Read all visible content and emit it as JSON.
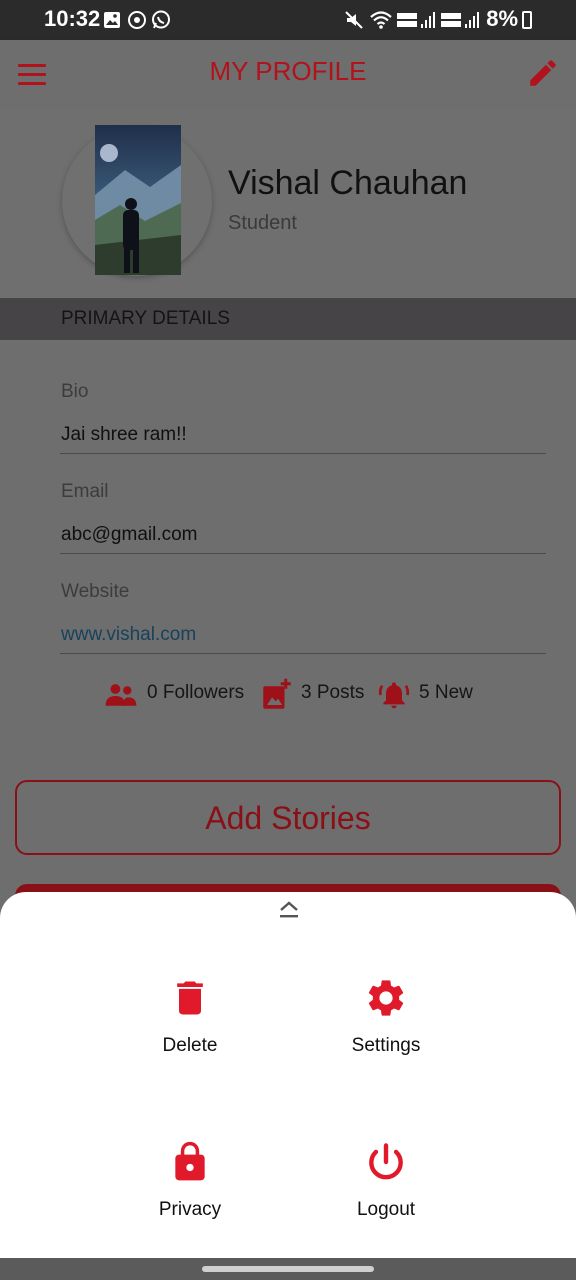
{
  "status_bar": {
    "time": "10:32",
    "battery": "8%"
  },
  "toolbar": {
    "title": "MY PROFILE",
    "menu_icon": "menu-icon",
    "edit_icon": "edit-pencil-icon"
  },
  "profile": {
    "name": "Vishal Chauhan",
    "role": "Student"
  },
  "section": {
    "title": "PRIMARY DETAILS"
  },
  "fields": [
    {
      "label": "Bio",
      "value": "Jai shree ram!!"
    },
    {
      "label": "Email",
      "value": "abc@gmail.com"
    },
    {
      "label": "Website",
      "value": "www.vishal.com"
    }
  ],
  "stats": {
    "followers": "0 Followers",
    "posts": "3 Posts",
    "notifications": "5 New"
  },
  "actions": {
    "add_stories": "Add Stories"
  },
  "sheet": {
    "items": [
      {
        "label": "Delete",
        "icon": "trash-icon"
      },
      {
        "label": "Settings",
        "icon": "gear-icon"
      },
      {
        "label": "Privacy",
        "icon": "lock-icon"
      },
      {
        "label": "Logout",
        "icon": "power-icon"
      }
    ]
  },
  "colors": {
    "accent": "#e01a2a",
    "dark_accent": "#b2121b",
    "link": "#18425a"
  }
}
